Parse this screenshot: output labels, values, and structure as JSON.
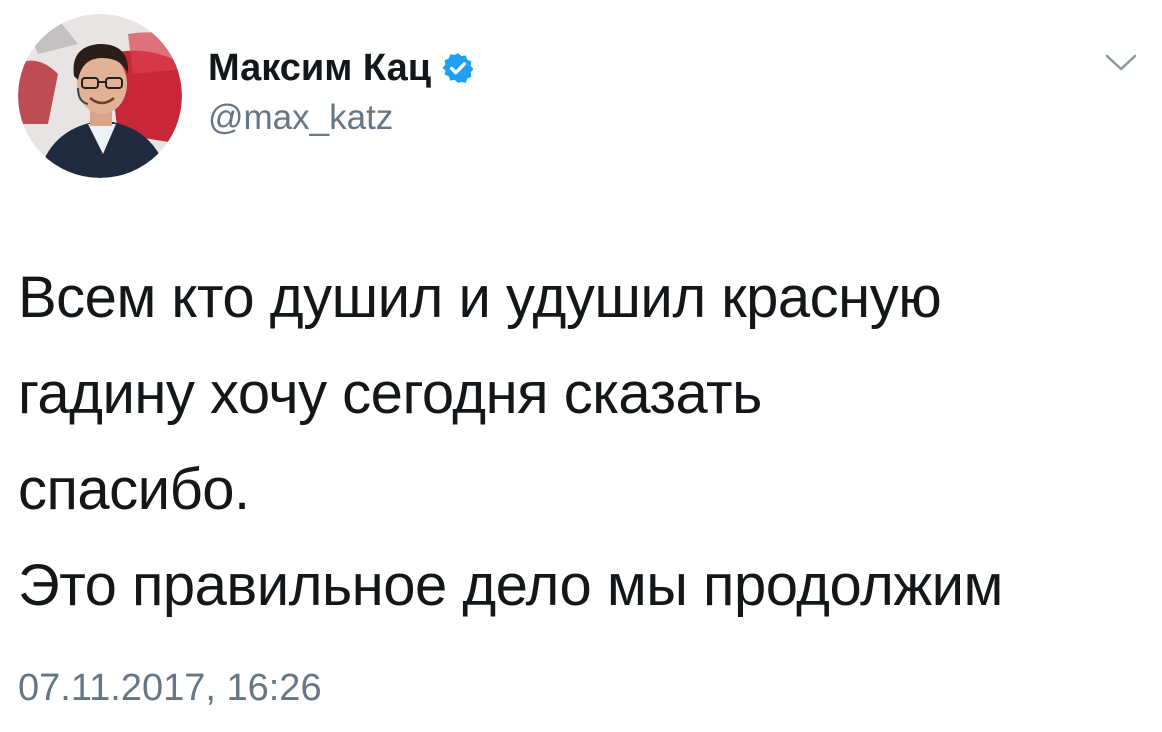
{
  "author": {
    "display_name": "Максим Кац",
    "handle": "@max_katz",
    "verified": true,
    "avatar_icon": "user-avatar-photo"
  },
  "tweet": {
    "lines": [
      "Всем кто душил и удушил красную",
      "гадину хочу сегодня сказать",
      "спасибо.",
      "Это правильное дело мы продолжим"
    ],
    "timestamp": "07.11.2017, 16:26"
  },
  "icons": {
    "verified": "verified-badge-icon",
    "menu": "chevron-down-icon"
  },
  "colors": {
    "verified_blue": "#1da1f2",
    "text_primary": "#14171a",
    "text_secondary": "#657786",
    "chevron": "#8899a6"
  }
}
